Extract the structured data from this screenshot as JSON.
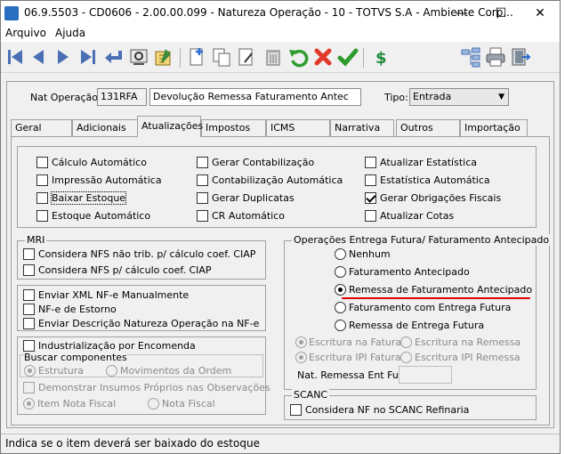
{
  "window": {
    "title": "06.9.5503 - CD0606 - 2.00.00.099 - Natureza Operação - 10 - TOTVS S.A - Ambiente Corp...",
    "minimize": "—",
    "maximize": "☐",
    "close": "✕"
  },
  "menu": {
    "arquivo": "Arquivo",
    "ajuda": "Ajuda"
  },
  "header": {
    "nat_label": "Nat Operação:",
    "nat_code": "131RFA",
    "nat_desc": "Devolução Remessa Faturamento Antec",
    "tipo_label": "Tipo:",
    "tipo_value": "Entrada"
  },
  "tabs": [
    "Geral",
    "Adicionais",
    "Atualizações",
    "Impostos",
    "ICMS",
    "Narrativa",
    "Outros",
    "Importação"
  ],
  "atualizacoes": {
    "calc_auto": "Cálculo Automático",
    "impressao_auto": "Impressão Automática",
    "baixar_estoque": "Baixar Estoque",
    "estoque_auto": "Estoque Automático",
    "gerar_contab": "Gerar Contabilização",
    "contab_auto": "Contabilização Automática",
    "gerar_dup": "Gerar Duplicatas",
    "cr_auto": "CR Automático",
    "atual_estat": "Atualizar Estatística",
    "estat_auto": "Estatística Automática",
    "gerar_obrig": "Gerar Obrigações Fiscais",
    "atual_cotas": "Atualizar Cotas"
  },
  "mri": {
    "title": "MRI",
    "nfs_nao_trib": "Considera NFS não trib. p/ cálculo coef. CIAP",
    "nfs_ciap": "Considera NFS p/ cálculo coef. CIAP"
  },
  "nfe": {
    "xml": "Enviar XML NF-e Manualmente",
    "estorno": "NF-e de Estorno",
    "desc_nat": "Enviar Descrição Natureza Operação na NF-e"
  },
  "industrializacao": {
    "title": "Industrialização por Encomenda",
    "buscar_title": "Buscar componentes",
    "estrutura": "Estrutura",
    "movimentos": "Movimentos da Ordem",
    "demonstrar": "Demonstrar Insumos Próprios nas Observações",
    "item_nf": "Item Nota Fiscal",
    "nota_fiscal": "Nota Fiscal"
  },
  "entrega_futura": {
    "title": "Operações Entrega Futura/ Faturamento Antecipado",
    "nenhum": "Nenhum",
    "fat_antecipado": "Faturamento Antecipado",
    "remessa_fat": "Remessa de Faturamento Antecipado",
    "fat_entrega": "Faturamento com Entrega Futura",
    "remessa_entrega": "Remessa de Entrega Futura",
    "escr_fatura": "Escritura na Fatura",
    "escr_remessa": "Escritura na Remessa",
    "escr_ipi_fatura": "Escritura IPI Fatura",
    "escr_ipi_remessa": "Escritura IPI Remessa",
    "nat_remessa_label": "Nat. Remessa Ent Fut:",
    "nat_remessa_value": ""
  },
  "scanc": {
    "title": "SCANC",
    "considera": "Considera NF no SCANC Refinaria"
  },
  "status": {
    "text": "Indica se o item deverá ser baixado do estoque"
  },
  "colors": {
    "accent_underline": "#e00000",
    "highlight": "#2a6fbf"
  }
}
